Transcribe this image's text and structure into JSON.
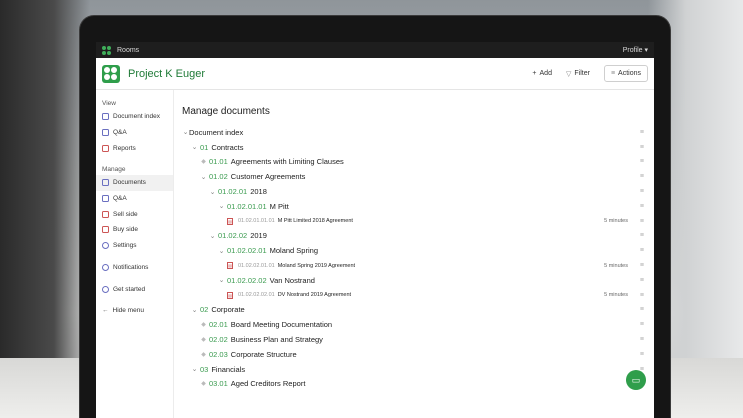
{
  "topbar": {
    "app": "Rooms",
    "profile": "Profile ▾"
  },
  "header": {
    "title": "Project K Euger",
    "add": "Add",
    "filter": "Filter",
    "actions": "Actions"
  },
  "sidebar": {
    "view_heading": "View",
    "view_items": [
      {
        "label": "Document index",
        "icon": "document-index-icon"
      },
      {
        "label": "Q&A",
        "icon": "qa-icon"
      },
      {
        "label": "Reports",
        "icon": "reports-icon"
      }
    ],
    "manage_heading": "Manage",
    "manage_items": [
      {
        "label": "Documents",
        "icon": "documents-icon"
      },
      {
        "label": "Q&A",
        "icon": "qa-icon"
      },
      {
        "label": "Sell side",
        "icon": "sell-side-icon"
      },
      {
        "label": "Buy side",
        "icon": "buy-side-icon"
      },
      {
        "label": "Settings",
        "icon": "settings-icon"
      }
    ],
    "notifications": "Notifications",
    "get_started": "Get started",
    "hide_menu": "Hide menu"
  },
  "main": {
    "title": "Manage documents",
    "tree": [
      {
        "indent": 0,
        "toggle": "open",
        "num": "",
        "label": "Document index"
      },
      {
        "indent": 1,
        "toggle": "open",
        "num": "01",
        "label": "Contracts"
      },
      {
        "indent": 2,
        "toggle": "leaf",
        "num": "01.01",
        "label": "Agreements with Limiting Clauses"
      },
      {
        "indent": 2,
        "toggle": "open",
        "num": "01.02",
        "label": "Customer Agreements"
      },
      {
        "indent": 3,
        "toggle": "open",
        "num": "01.02.01",
        "label": "2018"
      },
      {
        "indent": 4,
        "toggle": "open",
        "num": "01.02.01.01",
        "label": "M Pitt"
      },
      {
        "indent": 5,
        "toggle": "file",
        "num": "01.02.01.01.01",
        "label": "M Pitt Limited 2018 Agreement",
        "time": "5 minutes"
      },
      {
        "indent": 3,
        "toggle": "open",
        "num": "01.02.02",
        "label": "2019"
      },
      {
        "indent": 4,
        "toggle": "open",
        "num": "01.02.02.01",
        "label": "Moland Spring"
      },
      {
        "indent": 5,
        "toggle": "file",
        "num": "01.02.02.01.01",
        "label": "Moland Spring 2019 Agreement",
        "time": "5 minutes"
      },
      {
        "indent": 4,
        "toggle": "open",
        "num": "01.02.02.02",
        "label": "Van Nostrand"
      },
      {
        "indent": 5,
        "toggle": "file",
        "num": "01.02.02.02.01",
        "label": "DV Nostrand 2019 Agreement",
        "time": "5 minutes"
      },
      {
        "indent": 1,
        "toggle": "open",
        "num": "02",
        "label": "Corporate"
      },
      {
        "indent": 2,
        "toggle": "leaf",
        "num": "02.01",
        "label": "Board Meeting Documentation"
      },
      {
        "indent": 2,
        "toggle": "leaf",
        "num": "02.02",
        "label": "Business Plan and Strategy"
      },
      {
        "indent": 2,
        "toggle": "leaf",
        "num": "02.03",
        "label": "Corporate Structure"
      },
      {
        "indent": 1,
        "toggle": "open",
        "num": "03",
        "label": "Financials"
      },
      {
        "indent": 2,
        "toggle": "leaf",
        "num": "03.01",
        "label": "Aged Creditors Report"
      }
    ]
  },
  "colors": {
    "brand": "#2f9e4b",
    "number": "#3a9b4f"
  }
}
